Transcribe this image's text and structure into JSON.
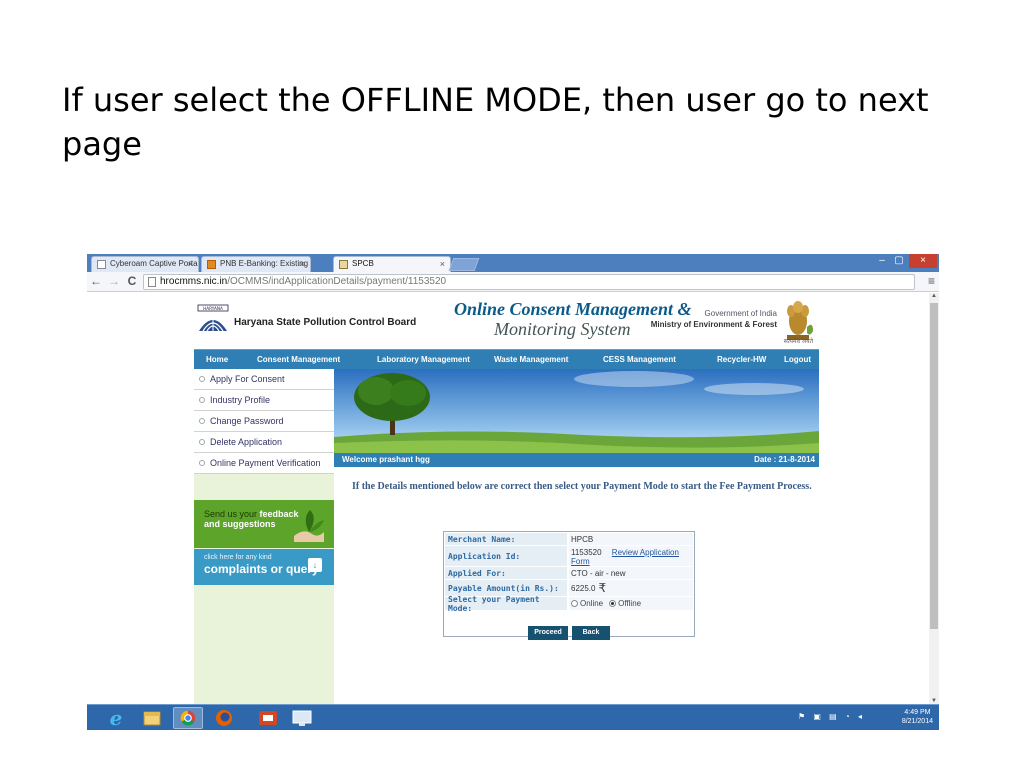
{
  "slide": {
    "title": "If user select the OFFLINE MODE, then user go to next page"
  },
  "browser": {
    "tabs": [
      {
        "label": "Cyberoam Captive Portal",
        "close": "×"
      },
      {
        "label": "PNB E-Banking: Existing u",
        "close": "×"
      },
      {
        "label": "SPCB",
        "close": "×"
      }
    ],
    "window_controls": {
      "minimize": "–",
      "maximize": "▢",
      "close": "×"
    },
    "nav": {
      "back": "←",
      "forward": "→",
      "reload": "C",
      "star": "☆",
      "menu": "≡"
    },
    "url": {
      "host": "hrocmms.nic.in",
      "path": "/OCMMS/indApplicationDetails/payment/1153520"
    }
  },
  "site": {
    "board_name": "Haryana State Pollution Control Board",
    "emblem_left_text": "HARYANA",
    "title_line1": "Online Consent Management &",
    "title_line2": "Monitoring System",
    "goi": "Government of India",
    "ministry": "Ministry of Environment & Forest",
    "satyamev": "सत्यमेव जयते",
    "topnav": [
      "Home",
      "Consent Management",
      "Laboratory Management",
      "Waste Management",
      "CESS Management",
      "Recycler-HW",
      "Logout"
    ],
    "leftnav": [
      "Apply For Consent",
      "Industry Profile",
      "Change Password",
      "Delete Application",
      "Online Payment Verification"
    ],
    "feedback": {
      "line1": "Send us your ",
      "line1_bold": "feedback",
      "line2": "and suggestions"
    },
    "complaints": {
      "small": "click here for any kind",
      "big": "complaints or query",
      "icon": "↓"
    },
    "welcome": "Welcome prashant hgg",
    "date": "Date : 21-8-2014",
    "instruction": "If the Details mentioned below are correct then select your Payment Mode to start the Fee Payment Process.",
    "payment": {
      "rows": [
        {
          "label": "Merchant Name:",
          "value": "HPCB"
        },
        {
          "label": "Application Id:",
          "value": "1153520",
          "link": "Review Application Form"
        },
        {
          "label": "Applied For:",
          "value": "CTO - air - new"
        },
        {
          "label": "Payable Amount(in Rs.):",
          "value": "6225.0",
          "currency": "₹"
        },
        {
          "label": "Select your Payment Mode:",
          "options": [
            "Online",
            "Offline"
          ],
          "selected": "Offline"
        }
      ],
      "proceed": "Proceed",
      "back": "Back"
    }
  },
  "taskbar": {
    "tray_flags": "⚑ ▣ ▤ ◔ ◂",
    "time": "4:49 PM",
    "date": "8/21/2014"
  }
}
